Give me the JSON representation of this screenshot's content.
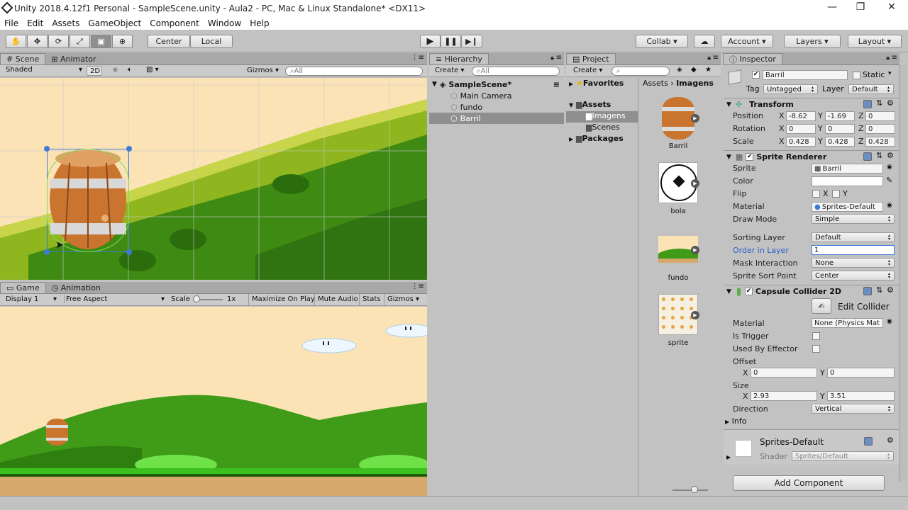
{
  "window": {
    "title": "Unity 2018.4.12f1 Personal - SampleScene.unity - Aula2 - PC, Mac & Linux Standalone* <DX11>"
  },
  "menu": [
    "File",
    "Edit",
    "Assets",
    "GameObject",
    "Component",
    "Window",
    "Help"
  ],
  "toolbar": {
    "center": "Center",
    "local": "Local",
    "collab": "Collab ▾",
    "account": "Account",
    "layers": "Layers",
    "layout": "Layout"
  },
  "scene": {
    "tabs": [
      "Scene",
      "Animator"
    ],
    "shaded": "Shaded",
    "mode2d": "2D",
    "gizmos": "Gizmos",
    "search": "All"
  },
  "game": {
    "tabs": [
      "Game",
      "Animation"
    ],
    "display": "Display 1",
    "aspect": "Free Aspect",
    "scale_label": "Scale",
    "scale_value": "1x",
    "options": [
      "Maximize On Play",
      "Mute Audio",
      "Stats",
      "Gizmos"
    ]
  },
  "hierarchy": {
    "tab": "Hierarchy",
    "create": "Create",
    "search": "All",
    "scene_name": "SampleScene*",
    "items": [
      "Main Camera",
      "fundo",
      "Barril"
    ]
  },
  "project": {
    "tab": "Project",
    "create": "Create",
    "tree": {
      "favorites": "Favorites",
      "assets": "Assets",
      "children": [
        "Imagens",
        "Scenes"
      ],
      "packages": "Packages"
    },
    "breadcrumb": [
      "Assets",
      "Imagens"
    ],
    "assets": [
      "Barril",
      "bola",
      "fundo",
      "sprite"
    ]
  },
  "inspector": {
    "tab": "Inspector",
    "object_name": "Barril",
    "static": "Static",
    "tag_label": "Tag",
    "tag": "Untagged",
    "layer_label": "Layer",
    "layer": "Default",
    "transform": {
      "title": "Transform",
      "position": {
        "label": "Position",
        "x": "-8.62",
        "y": "-1.69",
        "z": "0"
      },
      "rotation": {
        "label": "Rotation",
        "x": "0",
        "y": "0",
        "z": "0"
      },
      "scale": {
        "label": "Scale",
        "x": "0.428",
        "y": "0.428",
        "z": "0.428"
      }
    },
    "sprite_renderer": {
      "title": "Sprite Renderer",
      "labels": {
        "sprite": "Sprite",
        "color": "Color",
        "flip": "Flip",
        "material": "Material",
        "draw_mode": "Draw Mode",
        "sorting_layer": "Sorting Layer",
        "order": "Order in Layer",
        "mask": "Mask Interaction",
        "sort_point": "Sprite Sort Point"
      },
      "sprite": "Barril",
      "flip_x": "X",
      "flip_y": "Y",
      "material": "Sprites-Default",
      "draw_mode": "Simple",
      "sorting_layer": "Default",
      "order": "1",
      "mask": "None",
      "sort_point": "Center"
    },
    "collider": {
      "title": "Capsule Collider 2D",
      "edit": "Edit Collider",
      "labels": {
        "material": "Material",
        "trigger": "Is Trigger",
        "effector": "Used By Effector",
        "offset": "Offset",
        "size": "Size",
        "direction": "Direction",
        "info": "Info"
      },
      "material": "None (Physics Mat",
      "offset_x": "0",
      "offset_y": "0",
      "size_x": "2.93",
      "size_y": "3.51",
      "direction": "Vertical"
    },
    "material_preview": {
      "name": "Sprites-Default",
      "shader_label": "Shader",
      "shader": "Sprites/Default"
    },
    "add_component": "Add Component"
  },
  "colors": {
    "sky": "#fbe3b6",
    "grass_dark": "#3f8a12",
    "grass_light": "#8fc21e",
    "ground": "#d7a86c",
    "selection": "#3e7bd6"
  }
}
